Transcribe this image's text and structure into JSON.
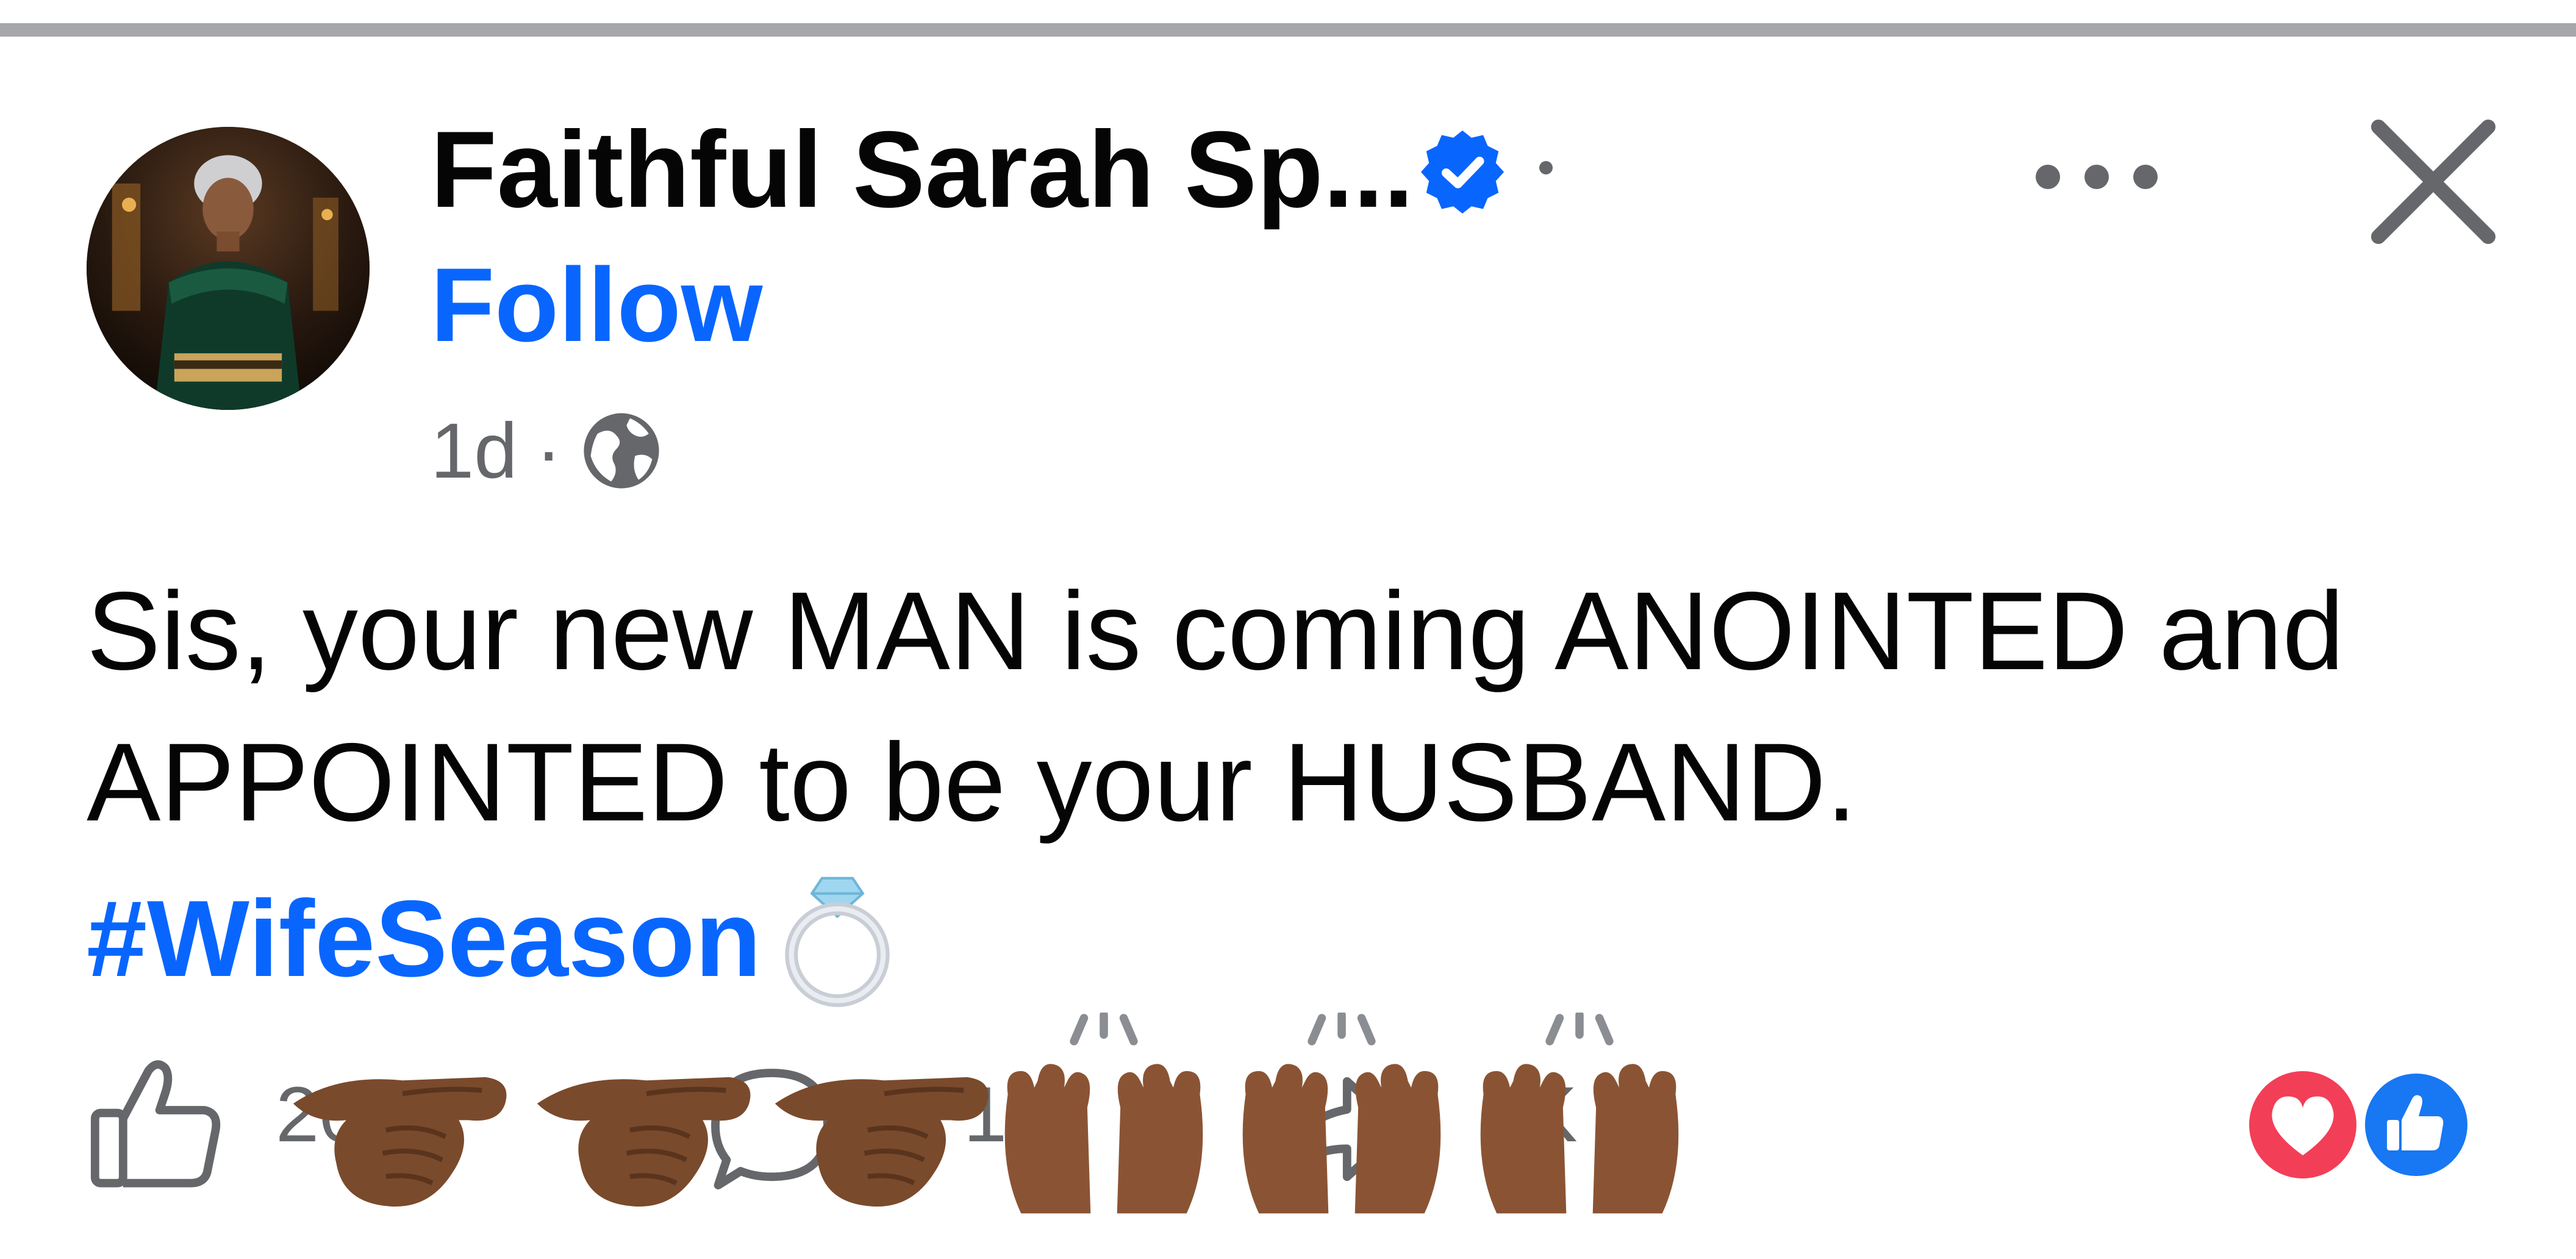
{
  "post": {
    "author_name": "Faithful Sarah Sp...",
    "follow_label": "Follow",
    "timestamp": "1d",
    "meta_separator": "·",
    "audience_icon": "globe-icon",
    "text_lines": [
      "Sis, your new MAN is coming ANOINTED and",
      "APPOINTED to be your HUSBAND."
    ],
    "hashtag": "#WifeSeason",
    "hashtag_emoji": "ring-emoji"
  },
  "header_actions": {
    "more_icon": "more-options-icon",
    "close_icon": "close-icon"
  },
  "action_bar": {
    "like_count": "20K",
    "comment_count": "1",
    "share_count": "2K",
    "reaction_icons": [
      "love-reaction-icon",
      "like-reaction-icon"
    ]
  },
  "colors": {
    "link_blue": "#0866ff",
    "text_primary": "#050505",
    "text_secondary": "#65676b",
    "verified_blue": "#0866ff",
    "love_red": "#f33e58",
    "divider_gray": "#a6a7ab"
  }
}
